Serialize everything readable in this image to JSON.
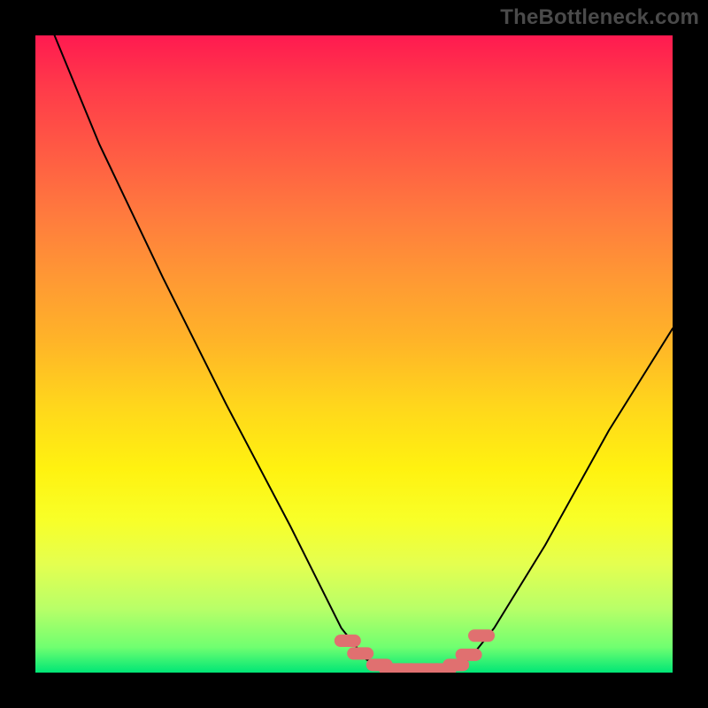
{
  "watermark": "TheBottleneck.com",
  "chart_data": {
    "type": "line",
    "title": "",
    "xlabel": "",
    "ylabel": "",
    "xlim": [
      0,
      100
    ],
    "ylim": [
      0,
      100
    ],
    "legend": false,
    "grid": false,
    "curve": [
      {
        "x": 3,
        "y": 100
      },
      {
        "x": 10,
        "y": 83
      },
      {
        "x": 20,
        "y": 62
      },
      {
        "x": 30,
        "y": 42
      },
      {
        "x": 40,
        "y": 23
      },
      {
        "x": 48,
        "y": 7
      },
      {
        "x": 52,
        "y": 2
      },
      {
        "x": 56,
        "y": 0.3
      },
      {
        "x": 60,
        "y": 0.3
      },
      {
        "x": 64,
        "y": 0.3
      },
      {
        "x": 68,
        "y": 2
      },
      {
        "x": 72,
        "y": 7
      },
      {
        "x": 80,
        "y": 20
      },
      {
        "x": 90,
        "y": 38
      },
      {
        "x": 100,
        "y": 54
      }
    ],
    "markers": [
      {
        "x": 49,
        "y": 5
      },
      {
        "x": 51,
        "y": 3
      },
      {
        "x": 54,
        "y": 1.2
      },
      {
        "x": 56,
        "y": 0.5
      },
      {
        "x": 58,
        "y": 0.5
      },
      {
        "x": 60,
        "y": 0.5
      },
      {
        "x": 62,
        "y": 0.5
      },
      {
        "x": 64,
        "y": 0.5
      },
      {
        "x": 66,
        "y": 1.2
      },
      {
        "x": 68,
        "y": 2.8
      },
      {
        "x": 70,
        "y": 5.8
      }
    ],
    "gradient_stops": [
      {
        "offset": 0,
        "color": "#ff1a50"
      },
      {
        "offset": 50,
        "color": "#ffd61c"
      },
      {
        "offset": 100,
        "color": "#00e676"
      }
    ]
  }
}
